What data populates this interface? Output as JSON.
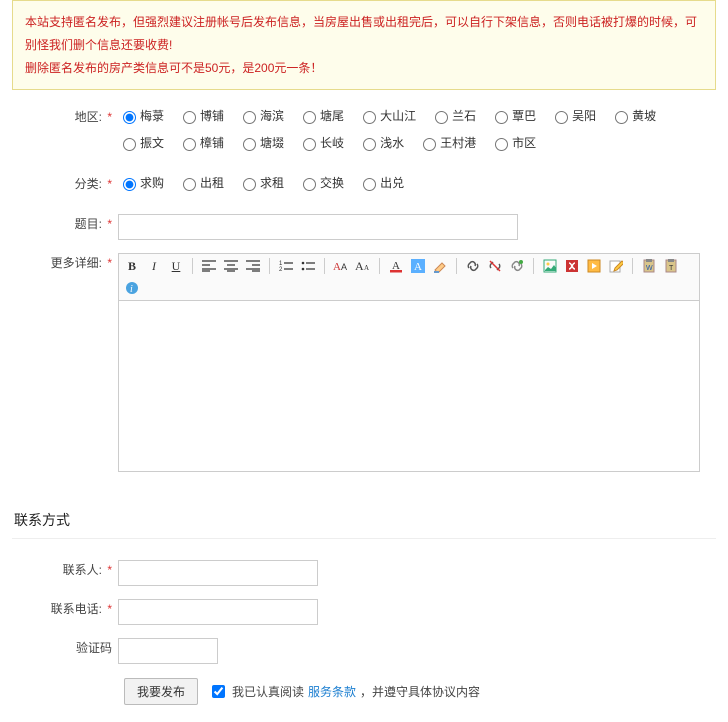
{
  "notice": {
    "line1": "本站支持匿名发布，但强烈建议注册帐号后发布信息，当房屋出售或出租完后，可以自行下架信息，否则电话被打爆的时候，可别怪我们删个信息还要收费!",
    "line2": "删除匿名发布的房产类信息可不是50元，是200元一条！"
  },
  "labels": {
    "area": "地区:",
    "category": "分类:",
    "title": "题目:",
    "detail": "更多详细:",
    "contact_section": "联系方式",
    "contact_name": "联系人:",
    "contact_phone": "联系电话:",
    "captcha": "验证码",
    "required": "*"
  },
  "area_options": [
    "梅菉",
    "博铺",
    "海滨",
    "塘尾",
    "大山江",
    "兰石",
    "覃巴",
    "吴阳",
    "黄坡",
    "振文",
    "樟铺",
    "塘㙍",
    "长岐",
    "浅水",
    "王村港",
    "市区"
  ],
  "category_options": [
    "求购",
    "出租",
    "求租",
    "交换",
    "出兑"
  ],
  "toolbar": {
    "bold": "B",
    "italic": "I",
    "underline": "U",
    "align_left": "left",
    "align_center": "center",
    "align_right": "right",
    "ol": "ol",
    "ul": "ul",
    "font_family": "fontfamily",
    "font_size": "fontsize",
    "fore_color": "forecolor",
    "back_color": "backcolor",
    "remove_format": "removeformat",
    "link": "link",
    "unlink": "unlink",
    "anchor": "anchor",
    "image": "image",
    "flash": "flash",
    "media": "media",
    "edit": "edit",
    "paste_word": "pasteword",
    "paste_plain": "pasteplain",
    "about": "about"
  },
  "submit": {
    "button": "我要发布",
    "agree_prefix": "我已认真阅读",
    "agree_link": "服务条款",
    "agree_suffix": "，并遵守具体协议内容"
  }
}
